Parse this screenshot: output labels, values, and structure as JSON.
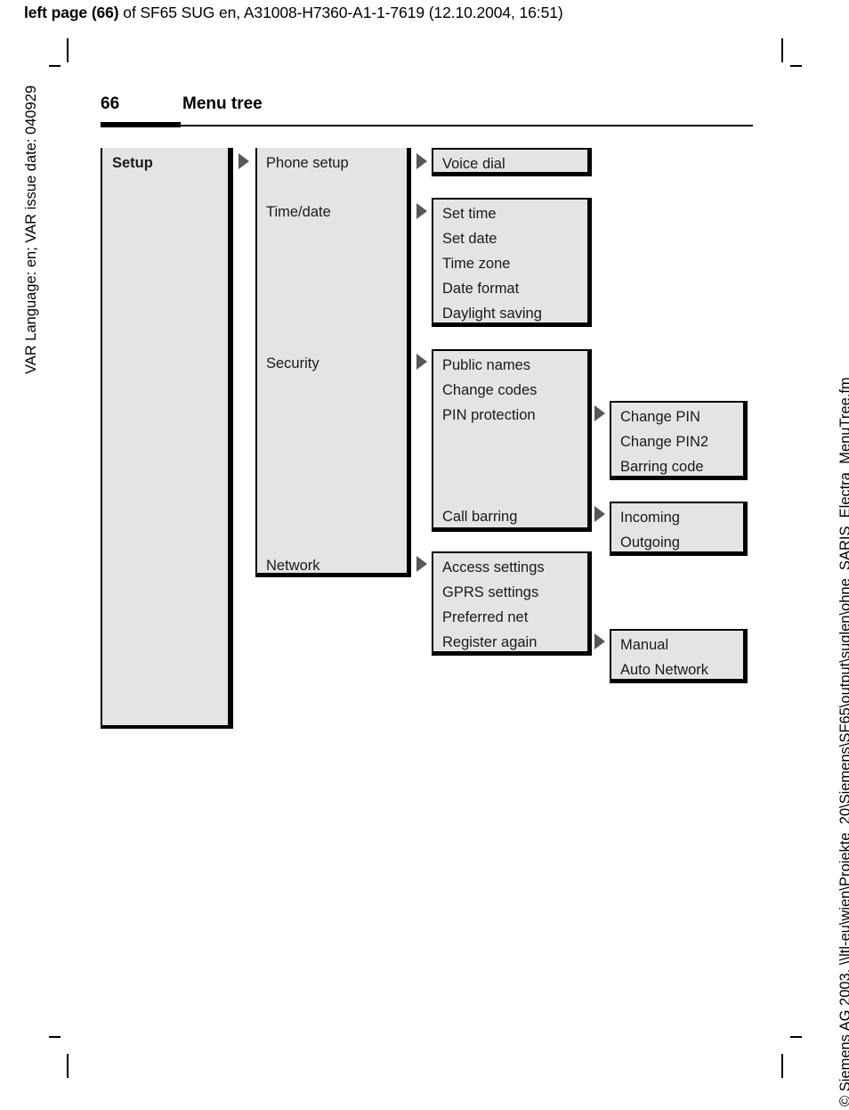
{
  "print_header": {
    "bold_prefix": "left page (66)",
    "rest": " of SF65 SUG en, A31008-H7360-A1-1-7619 (12.10.2004, 16:51)"
  },
  "side_text": {
    "left": "VAR Language: en; VAR issue date: 040929",
    "right": "© Siemens AG 2003, \\\\ltl-eu\\wien\\Projekte_20\\Siemens\\SF65\\output\\suglen\\ohne_SARIS_Electra_MenuTree.fm"
  },
  "page_header": {
    "number": "66",
    "title": "Menu tree"
  },
  "menu_tree": {
    "root": {
      "label": "Setup"
    },
    "level1": [
      {
        "label": "Phone setup"
      },
      {
        "label": "Time/date"
      },
      {
        "label": "Security"
      },
      {
        "label": "Network"
      }
    ],
    "level2": {
      "phone_setup": [
        "Voice dial"
      ],
      "time_date": [
        "Set time",
        "Set date",
        "Time zone",
        "Date format",
        "Daylight saving"
      ],
      "security": [
        "Public names",
        "Change codes",
        "PIN protection",
        "Call barring"
      ],
      "network": [
        "Access settings",
        "GPRS settings",
        "Preferred net",
        "Register again"
      ]
    },
    "level3": {
      "pin_protection": [
        "Change PIN",
        "Change PIN2",
        "Barring code"
      ],
      "call_barring": [
        "Incoming",
        "Outgoing"
      ],
      "register_again": [
        "Manual",
        "Auto Network"
      ]
    }
  },
  "colors": {
    "box_fill": "#e4e4e4",
    "border": "#000000",
    "arrow": "#575757"
  }
}
